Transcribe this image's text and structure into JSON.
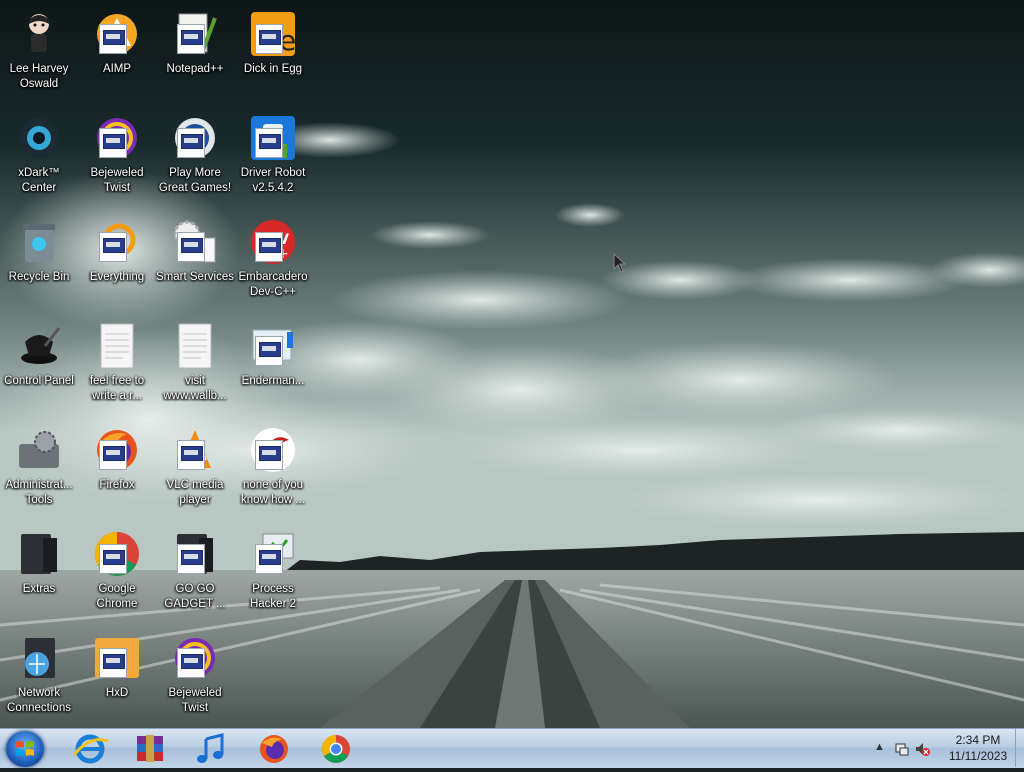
{
  "desktop": {
    "icons": [
      {
        "label": "Lee Harvey Oswald",
        "icon": "character-icon"
      },
      {
        "label": "AIMP",
        "icon": "aimp-icon"
      },
      {
        "label": "Notepad++",
        "icon": "notepad-icon"
      },
      {
        "label": "Dick in Egg",
        "icon": "egg-app-icon"
      },
      {
        "label": "xDark™ Center",
        "icon": "xdark-icon"
      },
      {
        "label": "Bejeweled Twist",
        "icon": "bejeweled-icon"
      },
      {
        "label": "Play More Great Games!",
        "icon": "games-icon"
      },
      {
        "label": "Driver Robot v2.5.4.2",
        "icon": "driver-robot-icon"
      },
      {
        "label": "Recycle Bin",
        "icon": "recycle-bin-icon"
      },
      {
        "label": "Everything",
        "icon": "everything-icon"
      },
      {
        "label": "Smart Services",
        "icon": "gear-icon"
      },
      {
        "label": "Embarcadero Dev-C++",
        "icon": "devcpp-icon"
      },
      {
        "label": "Control Panel",
        "icon": "control-panel-icon"
      },
      {
        "label": "feel free to write a r...",
        "icon": "text-file-icon"
      },
      {
        "label": "visit www.wallb...",
        "icon": "text-file-icon"
      },
      {
        "label": "Enderman...",
        "icon": "app-icon"
      },
      {
        "label": "Administrat... Tools",
        "icon": "admin-tools-icon"
      },
      {
        "label": "Firefox",
        "icon": "firefox-icon"
      },
      {
        "label": "VLC media player",
        "icon": "vlc-icon"
      },
      {
        "label": "none of you know how ...",
        "icon": "red-logo-icon"
      },
      {
        "label": "Extras",
        "icon": "folder-icon"
      },
      {
        "label": "Google Chrome",
        "icon": "chrome-icon"
      },
      {
        "label": "GO GO GADGET ...",
        "icon": "folder-icon"
      },
      {
        "label": "Process Hacker 2",
        "icon": "process-hacker-icon"
      },
      {
        "label": "Network Connections",
        "icon": "network-icon"
      },
      {
        "label": "HxD",
        "icon": "hxd-icon"
      },
      {
        "label": "Bejeweled Twist",
        "icon": "bejeweled-icon"
      }
    ]
  },
  "taskbar": {
    "start": "start-button",
    "pinned": [
      {
        "name": "internet-explorer-icon"
      },
      {
        "name": "winrar-icon"
      },
      {
        "name": "music-player-icon"
      },
      {
        "name": "firefox-icon"
      },
      {
        "name": "chrome-icon"
      }
    ],
    "clock": {
      "time": "2:34 PM",
      "date": "11/11/2023"
    },
    "tray_icons": [
      "show-hidden-icons-arrow",
      "network-icon",
      "volume-muted-icon"
    ]
  }
}
